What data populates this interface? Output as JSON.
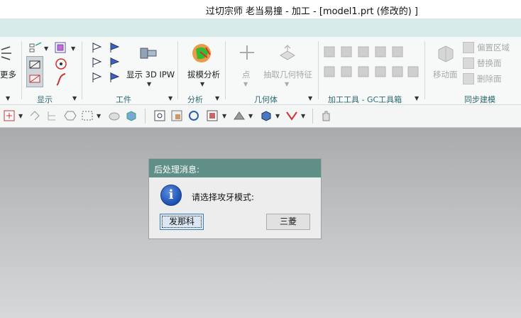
{
  "window": {
    "title": "过切宗师  老当易撞 - 加工  - [model1.prt  (修改的)  ]"
  },
  "ribbon": {
    "partial_more": "更多",
    "groups": {
      "display": "显示",
      "workpiece": "工件",
      "analysis": "分析",
      "geometry": "几何体",
      "gc_tools": "加工工具 - GC工具箱",
      "sync_model": "同步建模"
    },
    "buttons": {
      "show_3d_ipw": "显示 3D IPW",
      "draft_analysis": "拔模分析",
      "point": "点",
      "extract_geometry": "抽取几何特征",
      "move_face": "移动面",
      "offset_region": "偏置区域",
      "replace_face": "替换面",
      "delete_face": "删除面"
    }
  },
  "dialog": {
    "title": "后处理消息:",
    "icon": "info-icon",
    "message": "请选择攻牙模式:",
    "buttons": {
      "fanuc": "发那科",
      "mitsubishi": "三菱"
    }
  },
  "colors": {
    "ribbon_strip": "#d6ebea",
    "dialog_title": "#5f8f86",
    "group_label": "#2a6a72"
  }
}
